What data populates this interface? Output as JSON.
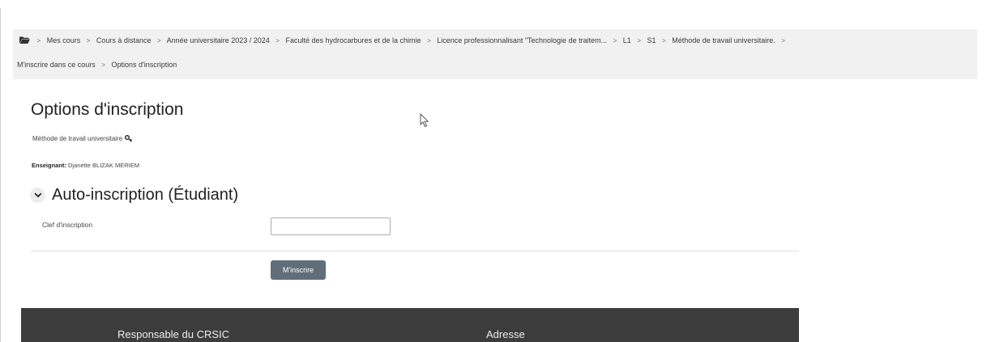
{
  "breadcrumb": {
    "items_row1": [
      "Mes cours",
      "Cours à distance",
      "Année universitaire 2023 / 2024",
      "Faculté des hydrocarbures et de la chimie",
      "Licence professionnalisant \"Technologie de traitem...",
      "L1",
      "S1",
      "Méthode de travail universitaire."
    ],
    "items_row2": [
      "M'inscrire dans ce cours",
      "Options d'inscription"
    ],
    "separator": ">"
  },
  "page": {
    "title": "Options d'inscription",
    "course_name": "Méthode de travail universitaire",
    "teacher_label": "Enseignant:",
    "teacher_name": "Djanette BLIZAK MERIEM"
  },
  "enrolment": {
    "section_title": "Auto-inscription (Étudiant)",
    "key_label": "Clef d'inscription",
    "key_value": "",
    "submit_label": "M'inscrire"
  },
  "footer": {
    "col1_heading": "Responsable du CRSIC",
    "col2_heading": "Adresse"
  },
  "colors": {
    "nav_background": "#f1f1f1",
    "button": "#5f6e78",
    "footer_background": "#3c3c3c"
  },
  "icons": {
    "breadcrumb_home": "folder-icon",
    "course_access": "key-icon",
    "section_toggle": "chevron-down-icon",
    "pointer": "mouse-cursor-icon"
  }
}
